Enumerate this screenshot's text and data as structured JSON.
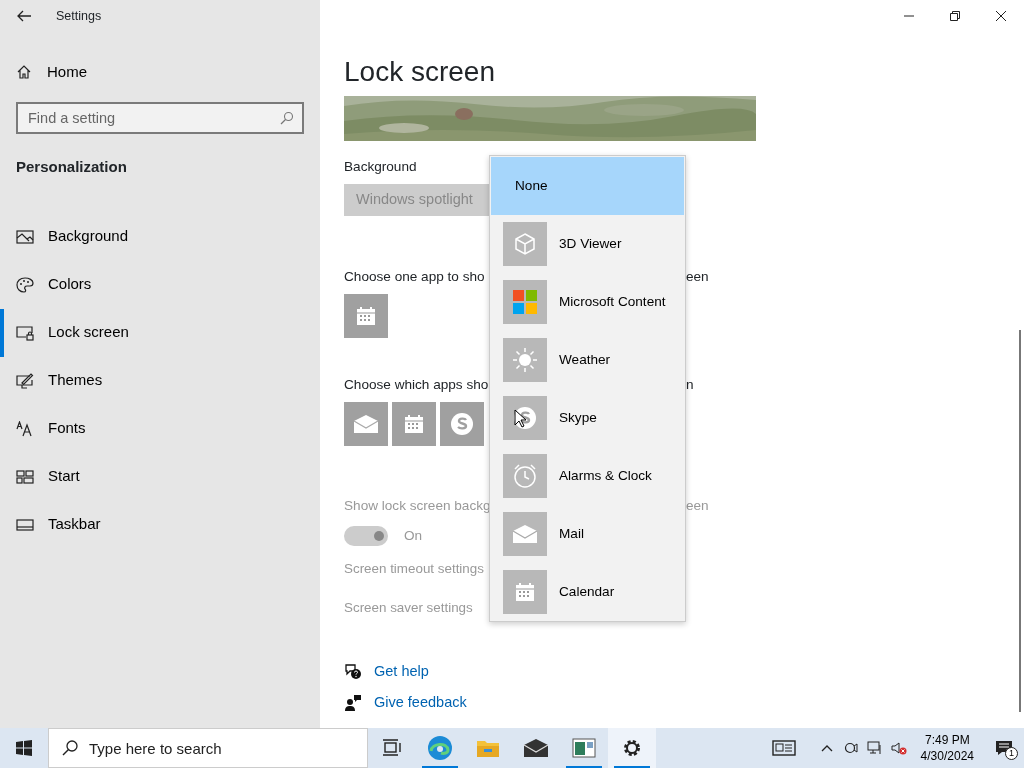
{
  "window": {
    "title": "Settings"
  },
  "sidebar": {
    "home": "Home",
    "search": {
      "placeholder": "Find a setting"
    },
    "section": "Personalization",
    "items": [
      {
        "label": "Background",
        "kind": "background",
        "selected": false
      },
      {
        "label": "Colors",
        "kind": "colors",
        "selected": false
      },
      {
        "label": "Lock screen",
        "kind": "lock",
        "selected": true
      },
      {
        "label": "Themes",
        "kind": "themes",
        "selected": false
      },
      {
        "label": "Fonts",
        "kind": "fonts",
        "selected": false
      },
      {
        "label": "Start",
        "kind": "start",
        "selected": false
      },
      {
        "label": "Taskbar",
        "kind": "taskbar",
        "selected": false
      }
    ]
  },
  "page": {
    "title": "Lock screen",
    "background": {
      "label": "Background",
      "value": "Windows spotlight",
      "disabled": true
    },
    "detailed_app": {
      "label_start": "Choose one app to sho",
      "label_end": "een",
      "apps": [
        {
          "kind": "calendar"
        }
      ]
    },
    "quick_apps": {
      "label_start": "Choose which apps sho",
      "label_end": "n",
      "apps": [
        {
          "kind": "mail"
        },
        {
          "kind": "calendar"
        },
        {
          "kind": "skype"
        }
      ]
    },
    "show_background": {
      "label_start": "Show lock screen backg",
      "label_end": "een",
      "on": true,
      "state_label": "On",
      "disabled": true
    },
    "links": [
      {
        "text": "Screen timeout settings",
        "disabled": true
      },
      {
        "text": "Screen saver settings",
        "disabled": true
      }
    ],
    "help": [
      {
        "kind": "help",
        "text": "Get help"
      },
      {
        "kind": "feedback",
        "text": "Give feedback"
      }
    ]
  },
  "dropdown": {
    "items": [
      {
        "label": "None",
        "kind": "none",
        "selected": true
      },
      {
        "label": "3D Viewer",
        "kind": "cube",
        "selected": false
      },
      {
        "label": "Microsoft Content",
        "kind": "tiles",
        "selected": false
      },
      {
        "label": "Weather",
        "kind": "sun",
        "selected": false
      },
      {
        "label": "Skype",
        "kind": "skype",
        "selected": false
      },
      {
        "label": "Alarms & Clock",
        "kind": "clock",
        "selected": false
      },
      {
        "label": "Mail",
        "kind": "mail",
        "selected": false
      },
      {
        "label": "Calendar",
        "kind": "calendar",
        "selected": false
      }
    ]
  },
  "taskbar": {
    "search": {
      "placeholder": "Type here to search"
    },
    "apps": [
      {
        "kind": "taskview",
        "running": false,
        "active": false
      },
      {
        "kind": "edge",
        "running": true,
        "active": false
      },
      {
        "kind": "folder",
        "running": false,
        "active": false
      },
      {
        "kind": "mail",
        "running": false,
        "active": false
      },
      {
        "kind": "window",
        "running": true,
        "active": false
      },
      {
        "kind": "settings",
        "running": true,
        "active": true
      }
    ],
    "clock": {
      "time": "7:49 PM",
      "date": "4/30/2024"
    },
    "notifications": {
      "count": "1"
    }
  }
}
